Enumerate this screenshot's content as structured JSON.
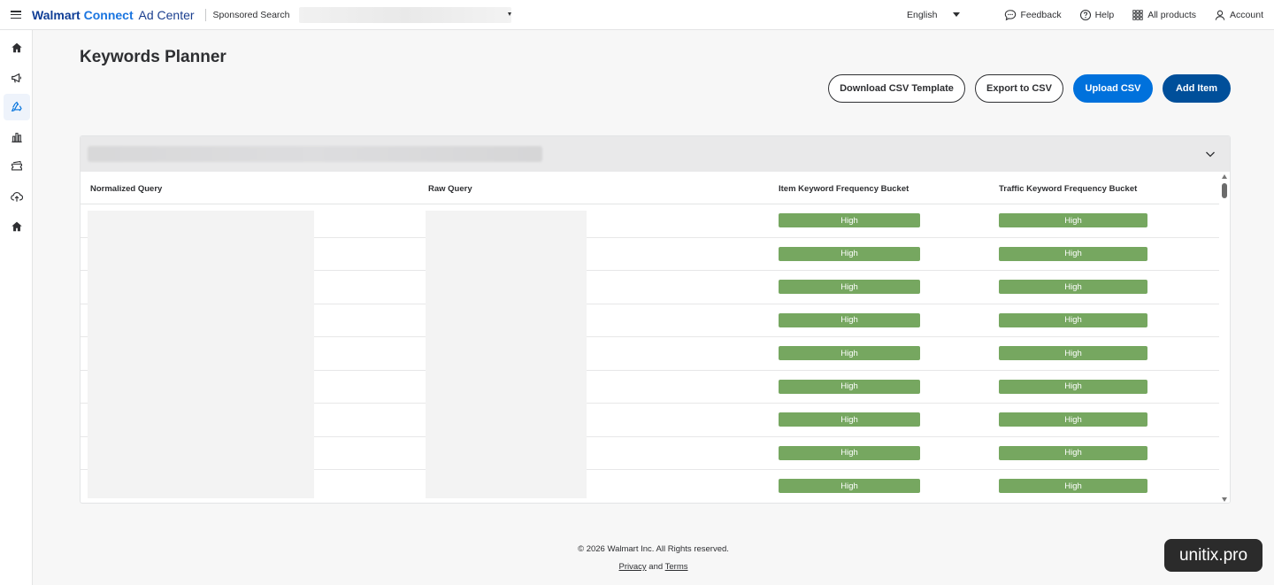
{
  "header": {
    "brand_part1": "Walmart",
    "brand_part2": "Connect",
    "brand_part3": "Ad Center",
    "product": "Sponsored Search",
    "language": "English",
    "feedback": "Feedback",
    "help": "Help",
    "all_products": "All products",
    "account": "Account"
  },
  "sidebar": {
    "items": [
      {
        "icon": "home-icon"
      },
      {
        "icon": "megaphone-icon"
      },
      {
        "icon": "recycle-icon"
      },
      {
        "icon": "bar-chart-icon"
      },
      {
        "icon": "ticket-icon"
      },
      {
        "icon": "cloud-upload-icon"
      },
      {
        "icon": "home-icon"
      }
    ]
  },
  "page": {
    "title": "Keywords Planner",
    "buttons": {
      "download_template": "Download CSV Template",
      "export": "Export to CSV",
      "upload": "Upload CSV",
      "add_item": "Add Item"
    }
  },
  "table": {
    "columns": [
      "Normalized Query",
      "Raw Query",
      "Item Keyword Frequency Bucket",
      "Traffic Keyword Frequency Bucket"
    ],
    "rows": [
      {
        "item_bucket": "High",
        "traffic_bucket": "High"
      },
      {
        "item_bucket": "High",
        "traffic_bucket": "High"
      },
      {
        "item_bucket": "High",
        "traffic_bucket": "High"
      },
      {
        "item_bucket": "High",
        "traffic_bucket": "High"
      },
      {
        "item_bucket": "High",
        "traffic_bucket": "High"
      },
      {
        "item_bucket": "High",
        "traffic_bucket": "High"
      },
      {
        "item_bucket": "High",
        "traffic_bucket": "High"
      },
      {
        "item_bucket": "High",
        "traffic_bucket": "High"
      },
      {
        "item_bucket": "High",
        "traffic_bucket": "High"
      }
    ]
  },
  "footer": {
    "copyright": "© 2026 Walmart Inc. All Rights reserved.",
    "privacy": "Privacy",
    "and": "and",
    "terms": "Terms"
  },
  "watermark": "unitix.pro",
  "colors": {
    "primary_blue": "#0071dc",
    "navy": "#004f9a",
    "badge_green": "#76a760"
  }
}
